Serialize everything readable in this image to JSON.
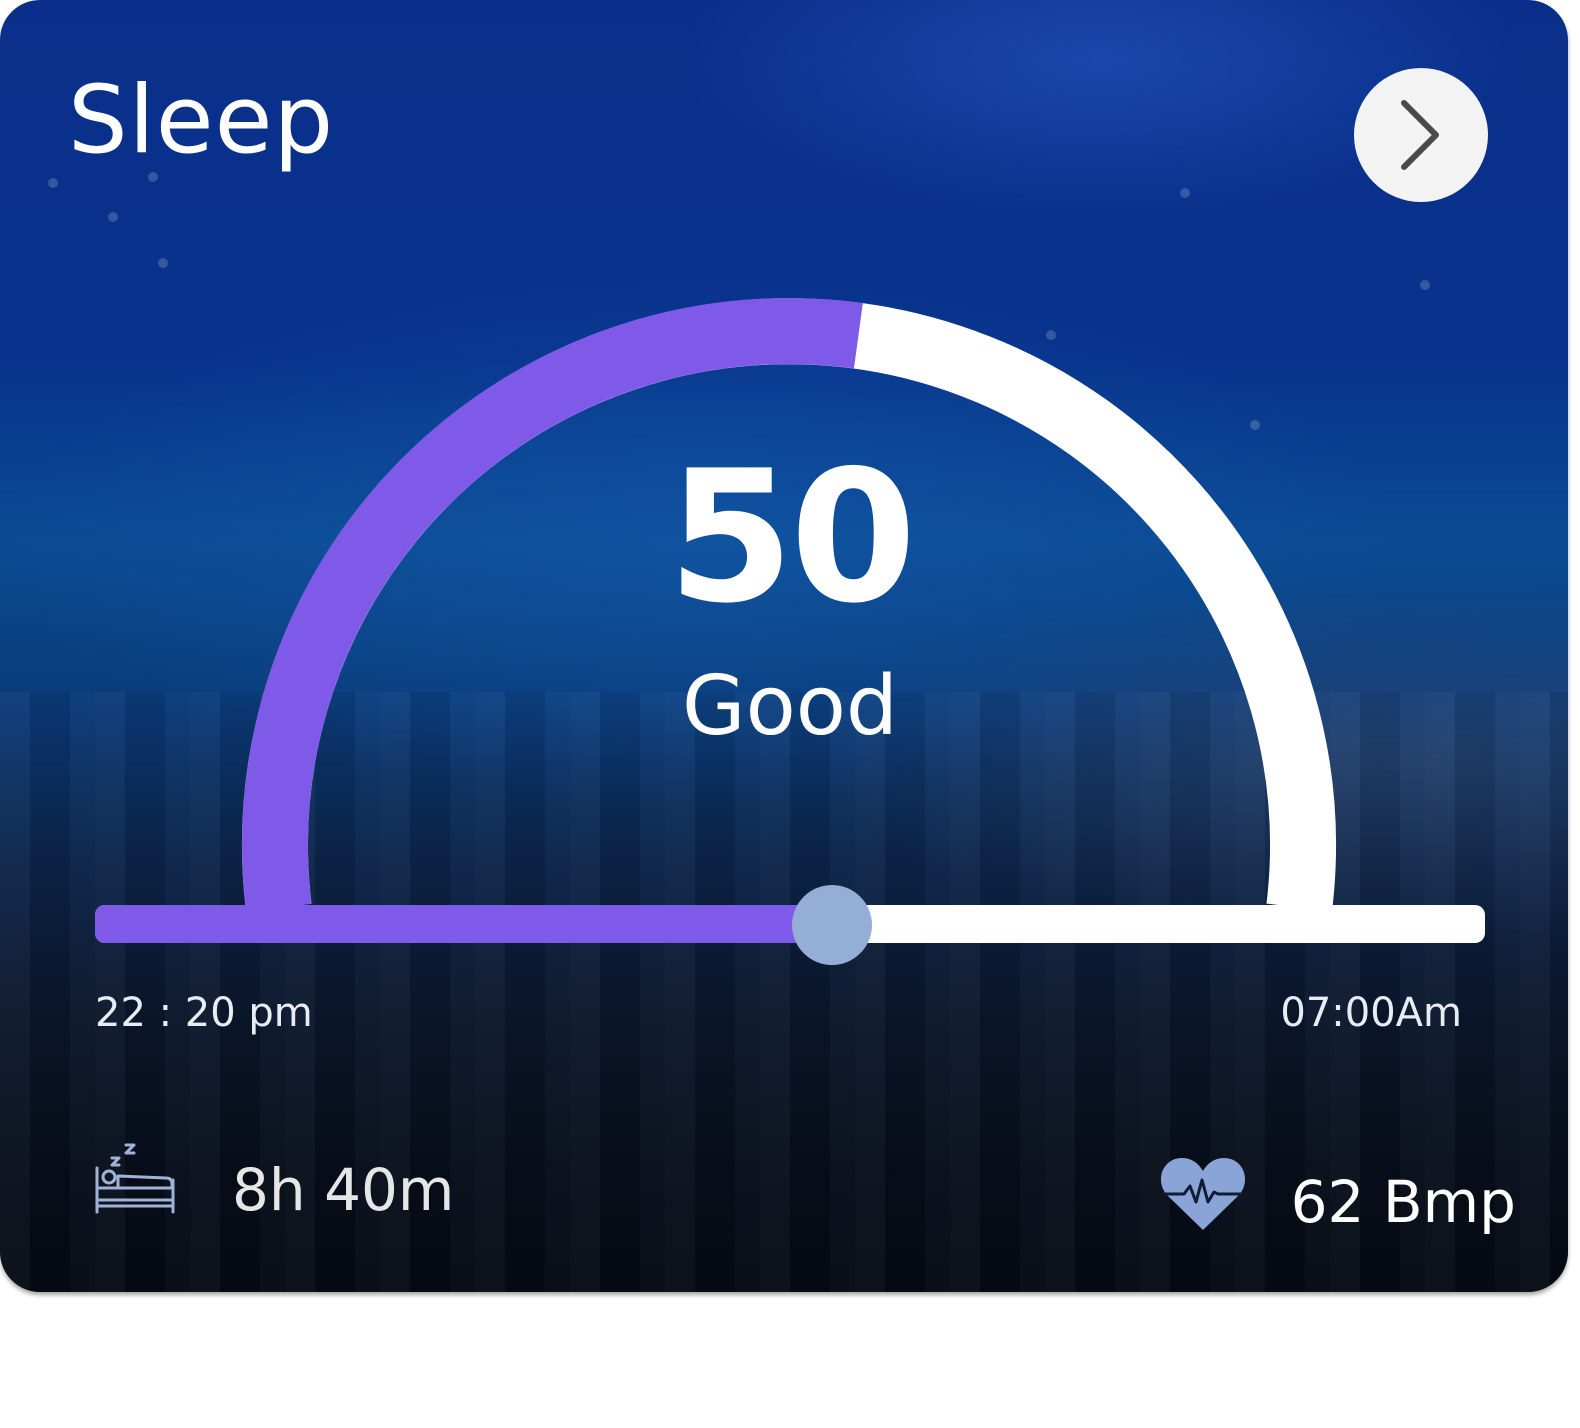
{
  "card": {
    "title": "Sleep",
    "next_icon": "chevron-right-icon"
  },
  "score": {
    "value": "50",
    "label": "Good",
    "gauge_progress": 0.54,
    "colors": {
      "fill": "#7f5ae8",
      "track": "#ffffff"
    }
  },
  "timeline": {
    "start": "22 : 20 pm",
    "end": "07:00Am",
    "progress": 0.53,
    "colors": {
      "fill": "#7f5ae8",
      "track": "#ffffff",
      "thumb": "#95aed6"
    }
  },
  "stats": {
    "duration": {
      "icon": "bed-icon",
      "value": "8h 40m"
    },
    "heart_rate": {
      "icon": "heart-rate-icon",
      "value": "62 Bmp"
    }
  }
}
